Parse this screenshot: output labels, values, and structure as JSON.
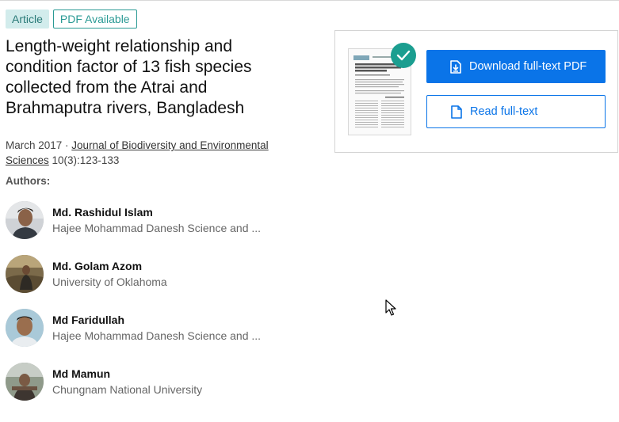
{
  "badges": {
    "article": "Article",
    "pdf": "PDF Available"
  },
  "publication": {
    "title": "Length-weight relationship and condition factor of 13 fish species collected from the Atrai and Brahmaputra rivers, Bangladesh",
    "date": "March 2017",
    "separator": " · ",
    "journal": "Journal of Biodiversity and Environmental Sciences",
    "volume": " 10(3):123-133"
  },
  "authors_label": "Authors:",
  "authors": [
    {
      "name": "Md. Rashidul Islam",
      "affiliation": "Hajee Mohammad Danesh Science and ..."
    },
    {
      "name": "Md. Golam Azom",
      "affiliation": "University of Oklahoma"
    },
    {
      "name": "Md Faridullah",
      "affiliation": "Hajee Mohammad Danesh Science and ..."
    },
    {
      "name": "Md Mamun",
      "affiliation": "Chungnam National University"
    }
  ],
  "actions": {
    "download": "Download full-text PDF",
    "read": "Read full-text"
  },
  "colors": {
    "primary": "#0a74e8",
    "teal": "#1b9e90",
    "badge_bg": "#d2ecec"
  },
  "icons": {
    "check": "check-icon",
    "download": "pdf-download-icon",
    "read": "document-icon",
    "cursor": "mouse-pointer-icon"
  }
}
